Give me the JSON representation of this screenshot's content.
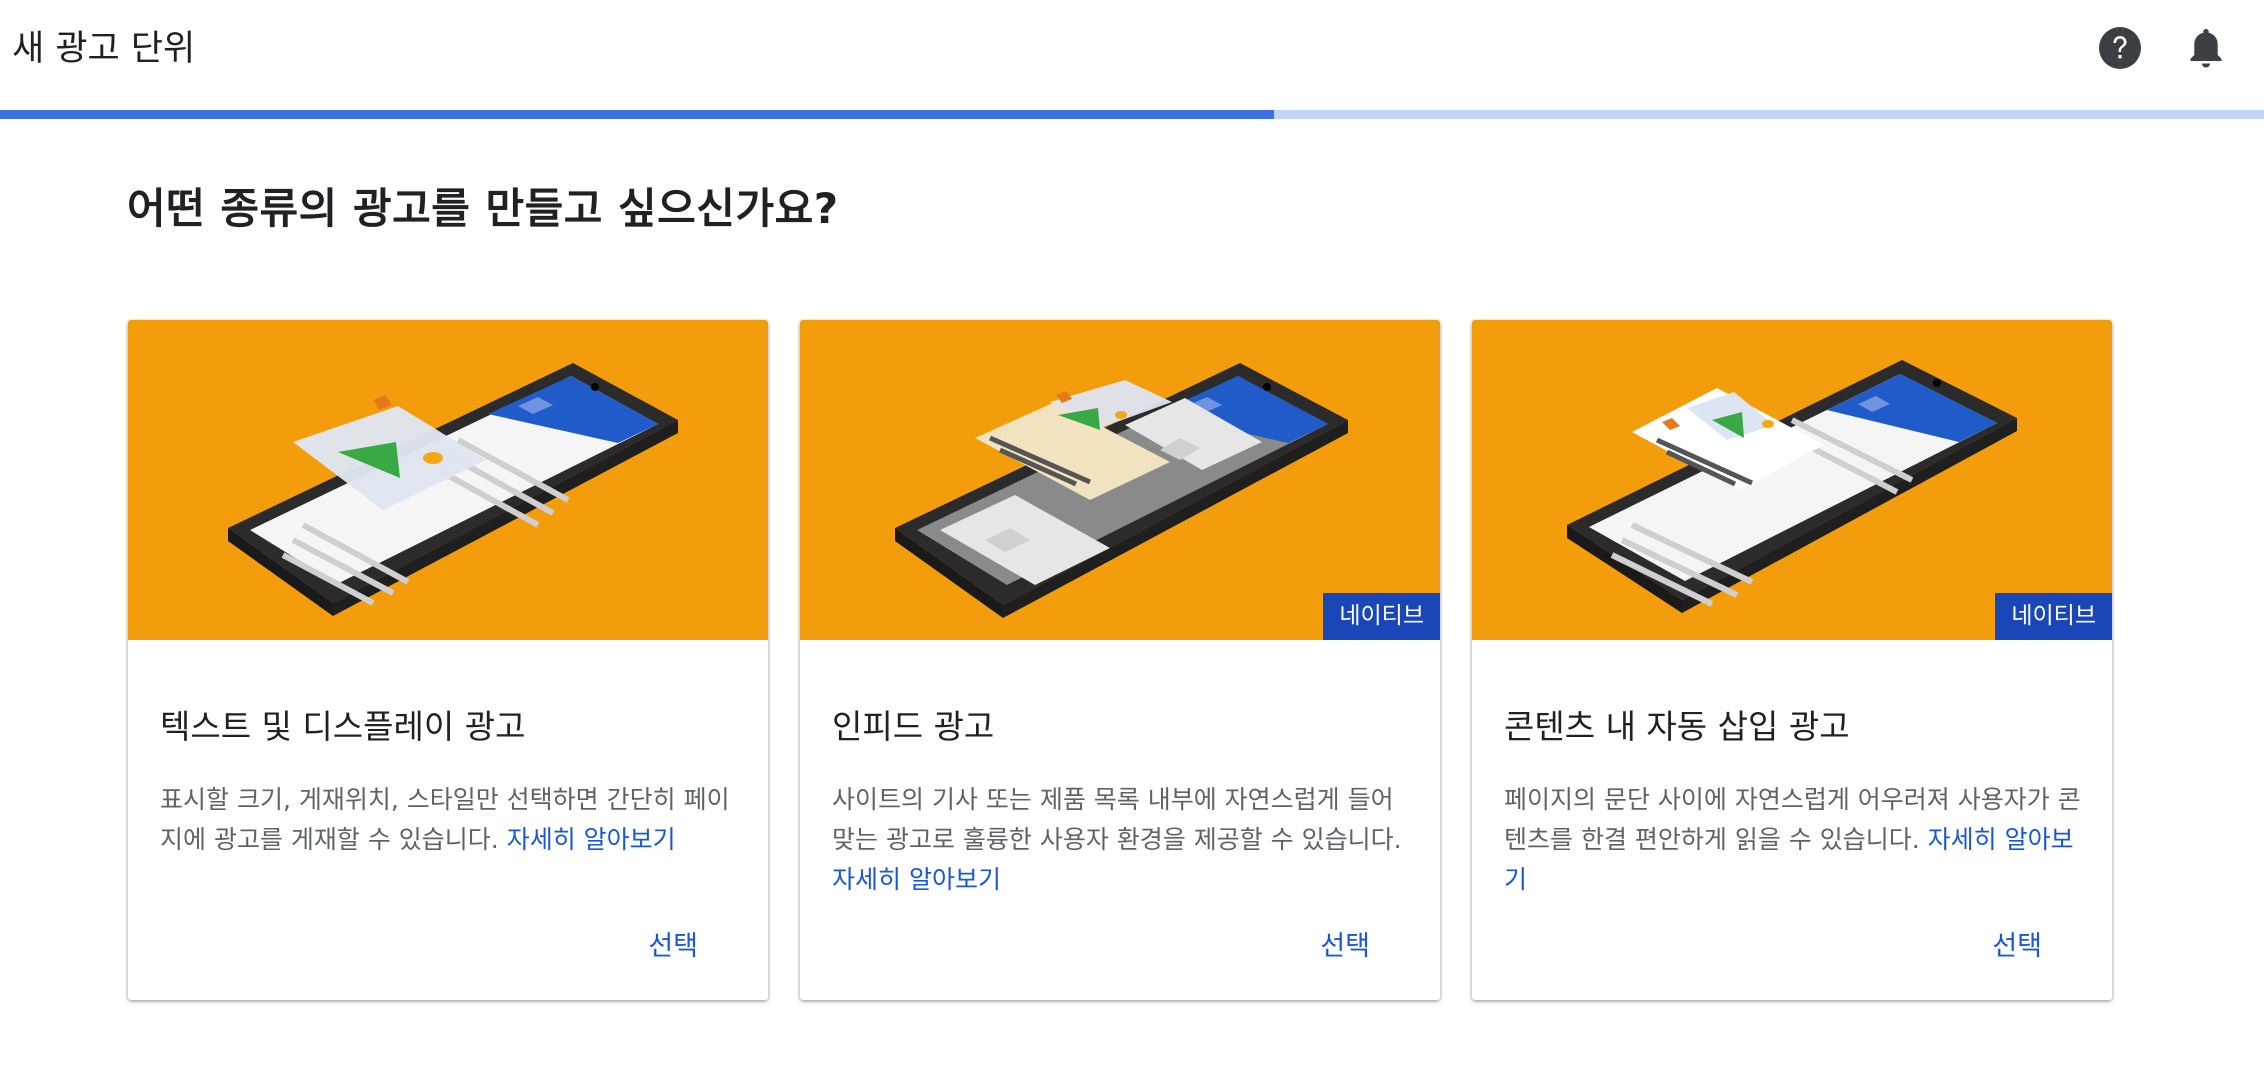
{
  "header": {
    "title": "새 광고 단위",
    "help_icon": "help-circle-icon",
    "notifications_icon": "bell-icon"
  },
  "progress": {
    "fraction": 0.5625
  },
  "colors": {
    "accent": "#3a70e0",
    "hero_background": "#f49d0c",
    "badge": "#1a47b8",
    "link": "#1a57d6"
  },
  "main": {
    "heading": "어떤 종류의 광고를 만들고 싶으신가요?",
    "cards": [
      {
        "title": "텍스트 및 디스플레이 광고",
        "description": "표시할 크기, 게재위치, 스타일만 선택하면 간단히 페이지에 광고를 게재할 수 있습니다.",
        "learn_more": "자세히 알아보기",
        "select": "선택",
        "badge": ""
      },
      {
        "title": "인피드 광고",
        "description": "사이트의 기사 또는 제품 목록 내부에 자연스럽게 들어맞는 광고로 훌륭한 사용자 환경을 제공할 수 있습니다.",
        "learn_more": "자세히 알아보기",
        "select": "선택",
        "badge": "네이티브"
      },
      {
        "title": "콘텐츠 내 자동 삽입 광고",
        "description": "페이지의 문단 사이에 자연스럽게 어우러져 사용자가 콘텐츠를 한결 편안하게 읽을 수 있습니다.",
        "learn_more": "자세히 알아보기",
        "select": "선택",
        "badge": "네이티브"
      }
    ]
  }
}
